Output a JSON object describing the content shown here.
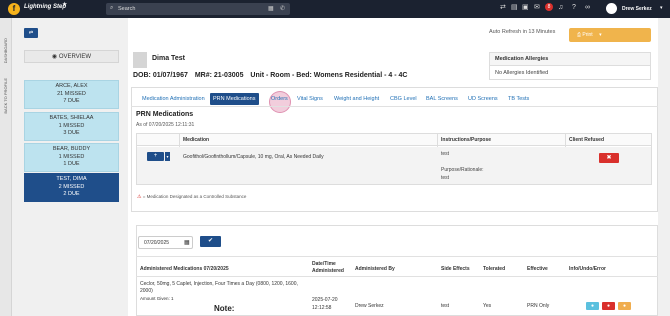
{
  "topbar": {
    "app_name": "Lightning Step",
    "logo_letter": "f",
    "search_placeholder": "Search",
    "notification_count": "8",
    "user_name": "Drew Serkez"
  },
  "sidebar_strip": {
    "label_1": "DASHBOARD",
    "label_2": "BACK TO PROFILE"
  },
  "left_panel": {
    "pin_label": "⇄",
    "overview_label": "OVERVIEW",
    "patients": [
      {
        "name": "ARCE, ALEX",
        "missed": "21 MISSED",
        "due": "7 DUE",
        "active": false
      },
      {
        "name": "BATES, SHIELAA",
        "missed": "1 MISSED",
        "due": "3 DUE",
        "active": false
      },
      {
        "name": "BEAR, BUDDY",
        "missed": "1 MISSED",
        "due": "1 DUE",
        "active": false
      },
      {
        "name": "TEST, DIMA",
        "missed": "2 MISSED",
        "due": "2 DUE",
        "active": true
      }
    ]
  },
  "header": {
    "auto_refresh": "Auto Refresh in 13 Minutes",
    "print_label": "Print",
    "patient_name": "Dima Test",
    "dob": "DOB: 01/07/1967",
    "mr": "MR#: 21-03005",
    "unit": "Unit - Room - Bed: Womens Residential - 4 - 4C"
  },
  "allergies": {
    "title": "Medication Allergies",
    "value": "No Allergies Identified"
  },
  "tabs": [
    {
      "label": "Medication Administration",
      "active": false
    },
    {
      "label": "PRN Medications",
      "active": true
    },
    {
      "label": "Orders",
      "active": false
    },
    {
      "label": "Vital Signs",
      "active": false
    },
    {
      "label": "Weight and Height",
      "active": false
    },
    {
      "label": "CBG Level",
      "active": false
    },
    {
      "label": "BAL Screens",
      "active": false
    },
    {
      "label": "UD Screens",
      "active": false
    },
    {
      "label": "TB Tests",
      "active": false
    }
  ],
  "prn": {
    "title": "PRN Medications",
    "as_of": "As of 07/20/2025 12:11:31",
    "columns": [
      "Medication",
      "Instructions/Purpose",
      "Client Refused"
    ],
    "row": {
      "medication": "Goofithol/Goofinthollum/Capsule, 10 mg, Oral, As Needed Daily",
      "instructions": "test",
      "purpose": "Purpose/Rationale:",
      "purpose_value": "test"
    },
    "legend": "= Medication Designated as a Controlled Substance"
  },
  "administered": {
    "date_value": "07/20/2025",
    "columns": [
      "Administered Medications 07/20/2025",
      "Date/Time Administered",
      "Administered By",
      "Side Effects",
      "Tolerated",
      "Effective",
      "Info/Undo/Error"
    ],
    "row": {
      "medication": "Ceclor, 50mg, 5 Caplet, Injection, Four Times a Day (0800, 1200, 1600, 2000)",
      "amount": "Amount Given: 1",
      "datetime_date": "2025-07-20",
      "datetime_time": "12:12:58",
      "by": "Drew Serkez",
      "side_effects": "test",
      "tolerated": "Yes",
      "effective": "PRN Only",
      "note": "Note:"
    }
  },
  "colors": {
    "navy": "#1f4e8a",
    "topbar": "#1b2230",
    "card": "#bde3ef",
    "danger": "#d9302c",
    "print": "#f0b44c"
  }
}
